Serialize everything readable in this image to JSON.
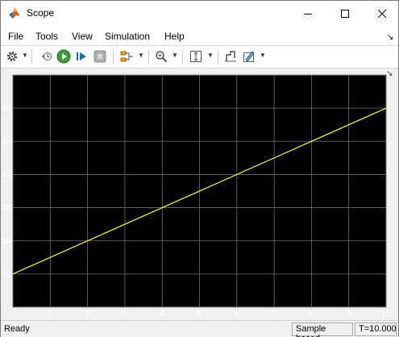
{
  "window": {
    "title": "Scope"
  },
  "menu": {
    "items": [
      "File",
      "Tools",
      "View",
      "Simulation",
      "Help"
    ]
  },
  "toolbar": {
    "icons": [
      "gear-icon",
      "step-back-icon",
      "run-icon",
      "step-forward-icon",
      "stop-icon",
      "signal-selector-icon",
      "zoom-icon",
      "autoscale-icon",
      "cursor-icon",
      "style-icon"
    ]
  },
  "status": {
    "ready": "Ready",
    "mode": "Sample based",
    "time": "T=10.000"
  },
  "colors": {
    "plot_bg": "#000000",
    "line": "#ffff00",
    "grid": "#6e6e6e",
    "axis_text": "#ffffff"
  },
  "chart_data": {
    "type": "line",
    "title": "",
    "xlabel": "",
    "ylabel": "",
    "xlim": [
      0,
      10
    ],
    "ylim": [
      0,
      70
    ],
    "x_ticks": [
      "0",
      "1",
      "2",
      "3",
      "4",
      "5",
      "6",
      "7",
      "8",
      "9",
      "10"
    ],
    "y_ticks": [
      "10",
      "20",
      "30",
      "40",
      "50",
      "60"
    ],
    "grid": true,
    "series": [
      {
        "x": [
          0,
          10
        ],
        "y": [
          10,
          60
        ]
      }
    ]
  }
}
